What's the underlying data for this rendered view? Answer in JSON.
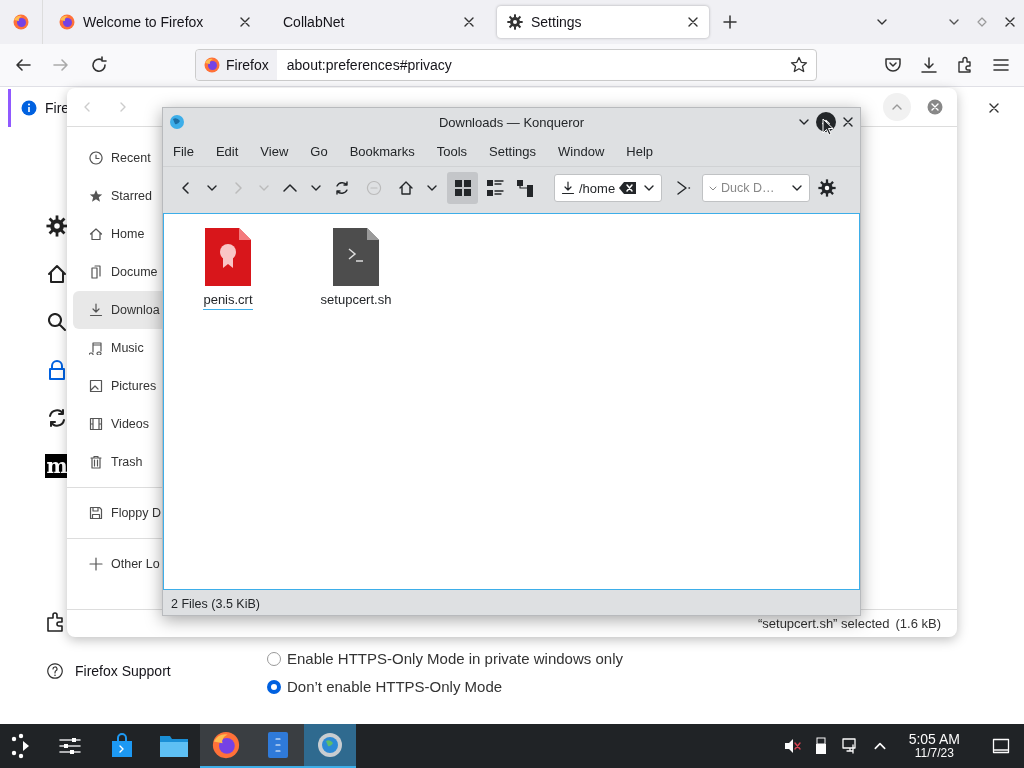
{
  "browser": {
    "tabs": [
      {
        "label": "Welcome to Firefox",
        "selected": false
      },
      {
        "label": "CollabNet",
        "selected": false
      },
      {
        "label": "Settings",
        "selected": true
      }
    ],
    "address": {
      "identity": "Firefox",
      "value": "about:preferences#privacy"
    },
    "notification": {
      "text": "Fire"
    },
    "categories": [
      {
        "selected": false
      },
      {
        "selected": false
      },
      {
        "selected": false
      },
      {
        "selected": true
      },
      {
        "selected": false
      },
      {
        "selected": false
      }
    ],
    "mozilla_badge": "m",
    "support_link": "Firefox Support",
    "https_options": [
      {
        "label": "Enable HTTPS-Only Mode in private windows only",
        "selected": false
      },
      {
        "label": "Don’t enable HTTPS-Only Mode",
        "selected": true
      }
    ]
  },
  "file_dialog": {
    "place_groups": [
      [
        {
          "label": "Recent",
          "selected": false
        },
        {
          "label": "Starred",
          "selected": false
        },
        {
          "label": "Home",
          "selected": false
        },
        {
          "label": "Docume",
          "selected": false
        },
        {
          "label": "Downloa",
          "selected": true
        },
        {
          "label": "Music",
          "selected": false
        },
        {
          "label": "Pictures",
          "selected": false
        },
        {
          "label": "Videos",
          "selected": false
        },
        {
          "label": "Trash",
          "selected": false
        }
      ],
      [
        {
          "label": "Floppy D",
          "selected": false
        }
      ],
      [
        {
          "label": "Other Lo",
          "selected": false
        }
      ]
    ],
    "status": "“setupcert.sh” selected",
    "size": "(1.6 kB)"
  },
  "konqueror": {
    "title": "Downloads — Konqueror",
    "menu": [
      "File",
      "Edit",
      "View",
      "Go",
      "Bookmarks",
      "Tools",
      "Settings",
      "Window",
      "Help"
    ],
    "view_modes": [
      {
        "selected": true
      },
      {
        "selected": false
      },
      {
        "selected": false
      }
    ],
    "location": "/home",
    "search_engine": "Duck D…",
    "files": [
      {
        "name": "penis.crt",
        "kind": "certificate",
        "selected": true
      },
      {
        "name": "setupcert.sh",
        "kind": "script",
        "selected": false
      }
    ],
    "status": "2 Files (3.5 KiB)"
  },
  "taskbar": {
    "apps": [
      {
        "open": false,
        "selected": false
      },
      {
        "open": false,
        "selected": false
      },
      {
        "open": false,
        "selected": false
      },
      {
        "open": true,
        "selected": false
      },
      {
        "open": true,
        "selected": false
      },
      {
        "open": true,
        "selected": true
      }
    ],
    "time": "5:05 AM",
    "date": "11/7/23"
  }
}
